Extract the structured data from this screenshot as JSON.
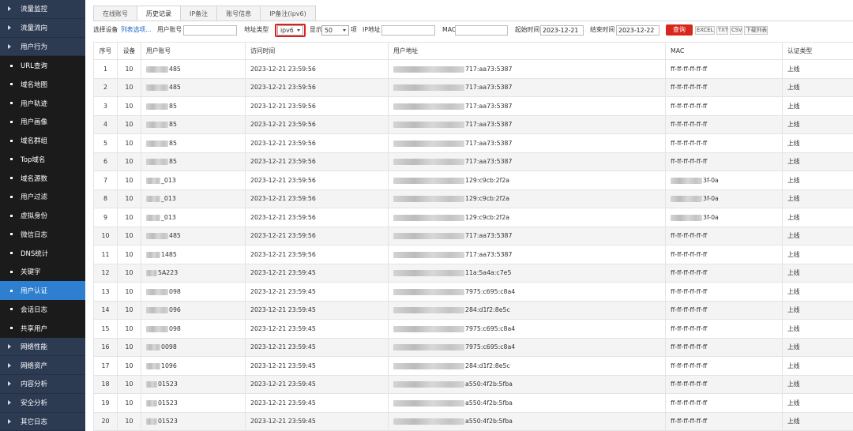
{
  "sidebar": {
    "items": [
      {
        "label": "流量监控",
        "type": "section"
      },
      {
        "label": "流量流向",
        "type": "section"
      },
      {
        "label": "用户行为",
        "type": "section"
      },
      {
        "label": "URL查询",
        "type": "sub"
      },
      {
        "label": "域名地图",
        "type": "sub"
      },
      {
        "label": "用户轨迹",
        "type": "sub"
      },
      {
        "label": "用户画像",
        "type": "sub"
      },
      {
        "label": "域名群组",
        "type": "sub"
      },
      {
        "label": "Top域名",
        "type": "sub"
      },
      {
        "label": "域名源数",
        "type": "sub"
      },
      {
        "label": "用户过滤",
        "type": "sub"
      },
      {
        "label": "虚拟身份",
        "type": "sub"
      },
      {
        "label": "微信日志",
        "type": "sub"
      },
      {
        "label": "DNS统计",
        "type": "sub"
      },
      {
        "label": "关键字",
        "type": "sub"
      },
      {
        "label": "用户认证",
        "type": "sub",
        "active": true
      },
      {
        "label": "会话日志",
        "type": "sub"
      },
      {
        "label": "共享用户",
        "type": "sub"
      },
      {
        "label": "网络性能",
        "type": "section"
      },
      {
        "label": "网络资产",
        "type": "section"
      },
      {
        "label": "内容分析",
        "type": "section"
      },
      {
        "label": "安全分析",
        "type": "section"
      },
      {
        "label": "其它日志",
        "type": "section"
      }
    ]
  },
  "tabs": [
    {
      "label": "在线账号"
    },
    {
      "label": "历史记录",
      "active": true
    },
    {
      "label": "IP备注"
    },
    {
      "label": "账号信息"
    },
    {
      "label": "IP备注(ipv6)"
    }
  ],
  "filters": {
    "device_label": "选择设备",
    "device_link": "列表选项...",
    "account_label": "用户账号",
    "account_value": "",
    "addr_type_label": "地址类型",
    "addr_type_value": "ipv6",
    "show_label": "显示",
    "show_value": "50",
    "items_label": "项",
    "ip_label": "IP地址",
    "ip_value": "",
    "mac_label": "MAC",
    "mac_value": "",
    "start_label": "起始时间",
    "start_value": "2023-12-21",
    "end_label": "结束时间",
    "end_value": "2023-12-22",
    "query_label": "查询",
    "export": [
      "EXCEL",
      "TXT",
      "CSV",
      "下载列表"
    ]
  },
  "table": {
    "columns": [
      "序号",
      "设备",
      "用户账号",
      "访问时间",
      "用户地址",
      "MAC",
      "认证类型"
    ],
    "rows": [
      {
        "no": "1",
        "dev": "10",
        "acct": "485",
        "time": "2023-12-21 23:59:56",
        "addr": "717:aa73:5387",
        "mac": "ff-ff-ff-ff-ff-ff",
        "type": "上线"
      },
      {
        "no": "2",
        "dev": "10",
        "acct": "485",
        "time": "2023-12-21 23:59:56",
        "addr": "717:aa73:5387",
        "mac": "ff-ff-ff-ff-ff-ff",
        "type": "上线"
      },
      {
        "no": "3",
        "dev": "10",
        "acct": "85",
        "time": "2023-12-21 23:59:56",
        "addr": "717:aa73:5387",
        "mac": "ff-ff-ff-ff-ff-ff",
        "type": "上线"
      },
      {
        "no": "4",
        "dev": "10",
        "acct": "85",
        "time": "2023-12-21 23:59:56",
        "addr": "717:aa73:5387",
        "mac": "ff-ff-ff-ff-ff-ff",
        "type": "上线"
      },
      {
        "no": "5",
        "dev": "10",
        "acct": "85",
        "time": "2023-12-21 23:59:56",
        "addr": "717:aa73:5387",
        "mac": "ff-ff-ff-ff-ff-ff",
        "type": "上线"
      },
      {
        "no": "6",
        "dev": "10",
        "acct": "85",
        "time": "2023-12-21 23:59:56",
        "addr": "717:aa73:5387",
        "mac": "ff-ff-ff-ff-ff-ff",
        "type": "上线"
      },
      {
        "no": "7",
        "dev": "10",
        "acct": "_013",
        "time": "2023-12-21 23:59:56",
        "addr": "129:c9cb:2f2a",
        "mac": "3f-0a",
        "type": "上线"
      },
      {
        "no": "8",
        "dev": "10",
        "acct": "_013",
        "time": "2023-12-21 23:59:56",
        "addr": "129:c9cb:2f2a",
        "mac": "3f-0a",
        "type": "上线"
      },
      {
        "no": "9",
        "dev": "10",
        "acct": "_013",
        "time": "2023-12-21 23:59:56",
        "addr": "129:c9cb:2f2a",
        "mac": "3f-0a",
        "type": "上线"
      },
      {
        "no": "10",
        "dev": "10",
        "acct": "485",
        "time": "2023-12-21 23:59:56",
        "addr": "717:aa73:5387",
        "mac": "ff-ff-ff-ff-ff-ff",
        "type": "上线"
      },
      {
        "no": "11",
        "dev": "10",
        "acct": "1485",
        "time": "2023-12-21 23:59:56",
        "addr": "717:aa73:5387",
        "mac": "ff-ff-ff-ff-ff-ff",
        "type": "上线"
      },
      {
        "no": "12",
        "dev": "10",
        "acct": "5A223",
        "time": "2023-12-21 23:59:45",
        "addr": "11a:5a4a:c7e5",
        "mac": "ff-ff-ff-ff-ff-ff",
        "type": "上线"
      },
      {
        "no": "13",
        "dev": "10",
        "acct": "098",
        "time": "2023-12-21 23:59:45",
        "addr": "7975:c695:c8a4",
        "mac": "ff-ff-ff-ff-ff-ff",
        "type": "上线"
      },
      {
        "no": "14",
        "dev": "10",
        "acct": "096",
        "time": "2023-12-21 23:59:45",
        "addr": "284:d1f2:8e5c",
        "mac": "ff-ff-ff-ff-ff-ff",
        "type": "上线"
      },
      {
        "no": "15",
        "dev": "10",
        "acct": "098",
        "time": "2023-12-21 23:59:45",
        "addr": "7975:c695:c8a4",
        "mac": "ff-ff-ff-ff-ff-ff",
        "type": "上线"
      },
      {
        "no": "16",
        "dev": "10",
        "acct": "0098",
        "time": "2023-12-21 23:59:45",
        "addr": "7975:c695:c8a4",
        "mac": "ff-ff-ff-ff-ff-ff",
        "type": "上线"
      },
      {
        "no": "17",
        "dev": "10",
        "acct": "1096",
        "time": "2023-12-21 23:59:45",
        "addr": "284:d1f2:8e5c",
        "mac": "ff-ff-ff-ff-ff-ff",
        "type": "上线"
      },
      {
        "no": "18",
        "dev": "10",
        "acct": "01523",
        "time": "2023-12-21 23:59:45",
        "addr": "a550:4f2b:5fba",
        "mac": "ff-ff-ff-ff-ff-ff",
        "type": "上线"
      },
      {
        "no": "19",
        "dev": "10",
        "acct": "01523",
        "time": "2023-12-21 23:59:45",
        "addr": "a550:4f2b:5fba",
        "mac": "ff-ff-ff-ff-ff-ff",
        "type": "上线"
      },
      {
        "no": "20",
        "dev": "10",
        "acct": "01523",
        "time": "2023-12-21 23:59:45",
        "addr": "a550:4f2b:5fba",
        "mac": "ff-ff-ff-ff-ff-ff",
        "type": "上线"
      }
    ]
  }
}
